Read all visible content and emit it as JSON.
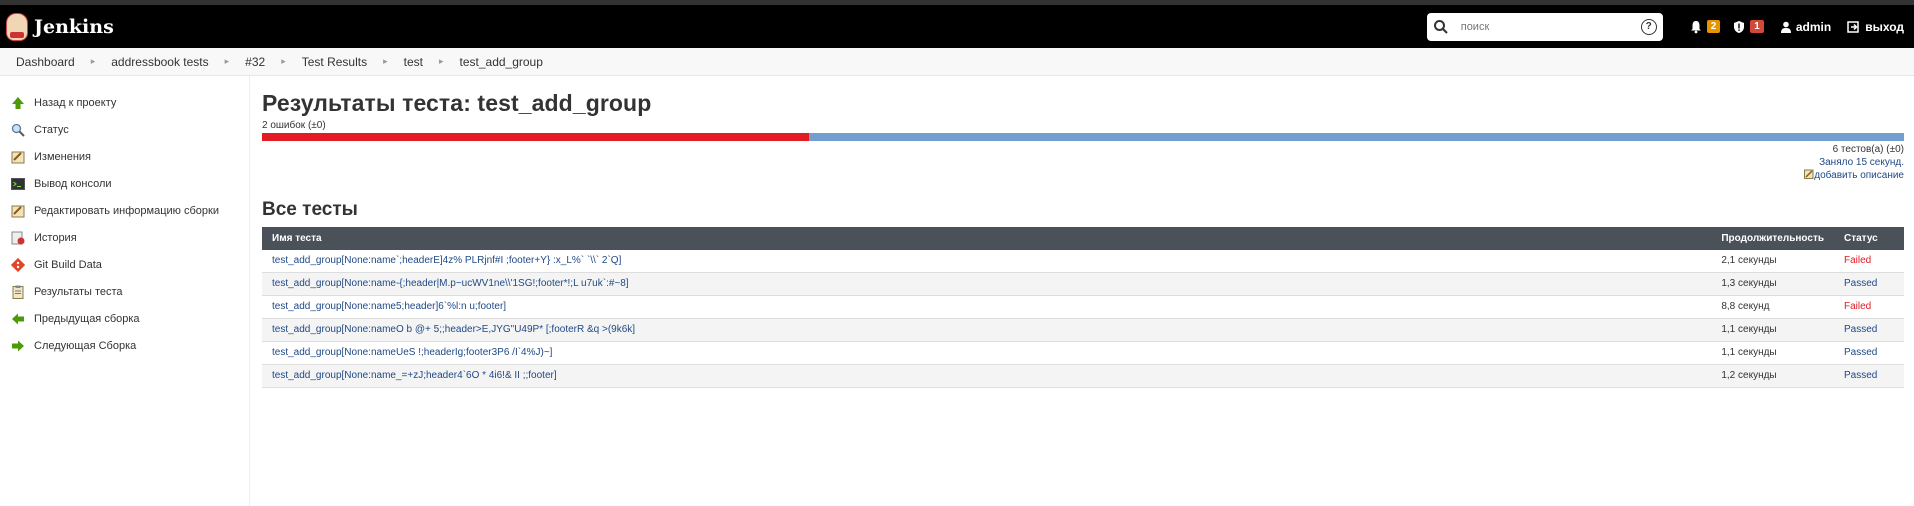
{
  "header": {
    "app_name": "Jenkins",
    "search_placeholder": "поиск",
    "notifications_count": "2",
    "security_count": "1",
    "user": "admin",
    "logout": "выход"
  },
  "breadcrumbs": [
    "Dashboard",
    "addressbook tests",
    "#32",
    "Test Results",
    "test",
    "test_add_group"
  ],
  "sidebar": {
    "items": [
      {
        "label": "Назад к проекту",
        "icon": "up-arrow-icon"
      },
      {
        "label": "Статус",
        "icon": "search-icon"
      },
      {
        "label": "Изменения",
        "icon": "notepad-icon"
      },
      {
        "label": "Вывод консоли",
        "icon": "terminal-icon"
      },
      {
        "label": "Редактировать информацию сборки",
        "icon": "notepad-icon"
      },
      {
        "label": "История",
        "icon": "history-icon"
      },
      {
        "label": "Git Build Data",
        "icon": "git-icon"
      },
      {
        "label": "Результаты теста",
        "icon": "clipboard-icon"
      },
      {
        "label": "Предыдущая сборка",
        "icon": "left-arrow-icon"
      },
      {
        "label": "Следующая Сборка",
        "icon": "right-arrow-icon"
      }
    ]
  },
  "main": {
    "title": "Результаты теста: test_add_group",
    "failures": "2 ошибок (±0)",
    "fail_fraction": 0.3333,
    "tests_count": "6 тестов(а) (±0)",
    "duration": "Заняло 15 секунд.",
    "add_description": "добавить описание",
    "all_tests_heading": "Все тесты",
    "table": {
      "headers": [
        "Имя теста",
        "Продолжительность",
        "Статус"
      ],
      "rows": [
        {
          "name": "test_add_group[None:name`;headerE]4z% PLRjnf#I ;footer+Y} :x_L%` `\\\\` 2`Q]",
          "duration": "2,1 секунды",
          "status": "Failed"
        },
        {
          "name": "test_add_group[None:name-{;header|M.p~ucWV1ne\\\\'1SG!;footer*!;L u7uk`:#~8]",
          "duration": "1,3 секунды",
          "status": "Passed"
        },
        {
          "name": "test_add_group[None:name5;header]6`%l:n u;footer]",
          "duration": "8,8 секунд",
          "status": "Failed"
        },
        {
          "name": "test_add_group[None:nameO b @+ 5;;header>E,JYG\"U49P* [;footerR &q >(9k6k]",
          "duration": "1,1 секунды",
          "status": "Passed"
        },
        {
          "name": "test_add_group[None:nameUeS !;headerIg;footer3P6 /I`4%J)~]",
          "duration": "1,1 секунды",
          "status": "Passed"
        },
        {
          "name": "test_add_group[None:name_=+zJ;header4`6O * 4i6!& II ;;footer]",
          "duration": "1,2 секунды",
          "status": "Passed"
        }
      ]
    }
  },
  "colors": {
    "fail": "#e31b23",
    "pass": "#729fcf",
    "link": "#204a87",
    "header_bg": "#000000",
    "table_head": "#4a5159"
  }
}
